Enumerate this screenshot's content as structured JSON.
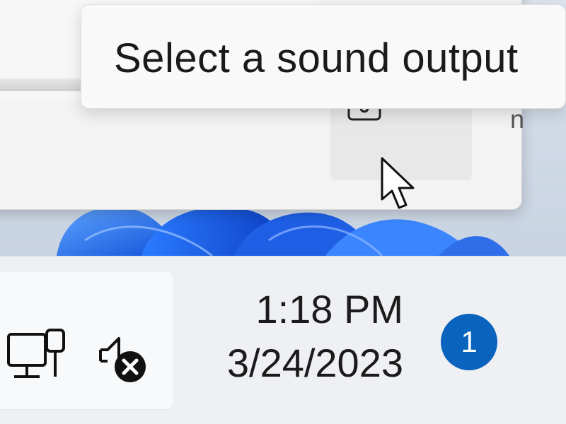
{
  "tooltip": {
    "text": "Select a sound output"
  },
  "flyout": {
    "output_button_icons": [
      "speaker-icon",
      "chevron-right-icon"
    ],
    "edge_glyph": "n"
  },
  "taskbar": {
    "tray_icons": [
      "network-ethernet-icon",
      "volume-muted-icon"
    ],
    "clock": {
      "time": "1:18 PM",
      "date": "3/24/2023"
    },
    "notification_count": "1"
  },
  "colors": {
    "notification_badge": "#0a63bd",
    "wallpaper_blue": "#1f6ff0",
    "flyout_bg": "#f3f3f3",
    "taskbar_bg": "#eef0f3"
  }
}
